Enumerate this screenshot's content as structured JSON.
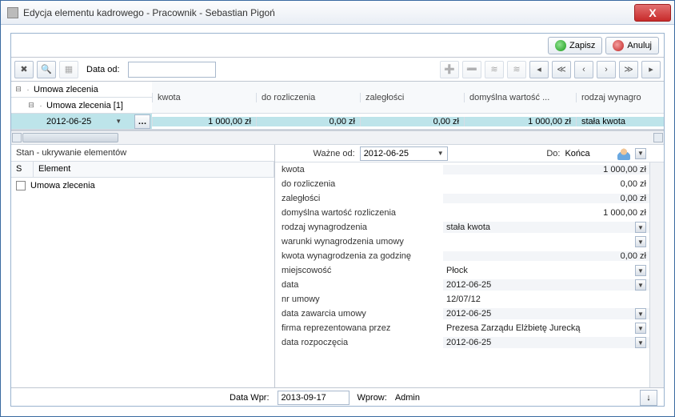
{
  "window": {
    "title": "Edycja elementu kadrowego - Pracownik - Sebastian Pigoń"
  },
  "actions": {
    "save": "Zapisz",
    "cancel": "Anuluj"
  },
  "toolbar": {
    "date_from_label": "Data od:",
    "date_from_value": ""
  },
  "tree": {
    "root": "Umowa zlecenia",
    "child": "Umowa zlecenia [1]",
    "leaf": "2012-06-25"
  },
  "grid": {
    "columns": [
      "kwota",
      "do rozliczenia",
      "zaległości",
      "domyślna wartość ...",
      "rodzaj wynagro"
    ],
    "row": [
      "1 000,00 zł",
      "0,00 zł",
      "0,00 zł",
      "1 000,00 zł",
      "stała kwota"
    ]
  },
  "left_panel": {
    "title": "Stan - ukrywanie elementów",
    "cols": [
      "S",
      "Element"
    ],
    "item": "Umowa zlecenia"
  },
  "form": {
    "valid_from_label": "Ważne od:",
    "valid_from_value": "2012-06-25",
    "to_label": "Do:",
    "to_value": "Końca",
    "rows": [
      {
        "k": "kwota",
        "v": "1 000,00 zł",
        "align": "right",
        "dd": false
      },
      {
        "k": "do rozliczenia",
        "v": "0,00 zł",
        "align": "right",
        "dd": false
      },
      {
        "k": "zaległości",
        "v": "0,00 zł",
        "align": "right",
        "dd": false
      },
      {
        "k": "domyślna wartość rozliczenia",
        "v": "1 000,00 zł",
        "align": "right",
        "dd": false
      },
      {
        "k": "rodzaj wynagrodzenia",
        "v": "stała kwota",
        "align": "left",
        "dd": true
      },
      {
        "k": "warunki wynagrodzenia umowy",
        "v": "",
        "align": "left",
        "dd": true
      },
      {
        "k": "kwota wynagrodzenia za godzinę",
        "v": "0,00 zł",
        "align": "right",
        "dd": false
      },
      {
        "k": "miejscowość",
        "v": "Płock",
        "align": "left",
        "dd": true
      },
      {
        "k": "data",
        "v": "2012-06-25",
        "align": "left",
        "dd": true
      },
      {
        "k": "nr umowy",
        "v": "12/07/12",
        "align": "left",
        "dd": false
      },
      {
        "k": "data zawarcia umowy",
        "v": "2012-06-25",
        "align": "left",
        "dd": true
      },
      {
        "k": "firma reprezentowana przez",
        "v": "Prezesa Zarządu Elżbietę Jurecką",
        "align": "left",
        "dd": true
      },
      {
        "k": "data rozpoczęcia",
        "v": "2012-06-25",
        "align": "left",
        "dd": true
      }
    ]
  },
  "footer": {
    "date_wpr_label": "Data Wpr:",
    "date_wpr_value": "2013-09-17",
    "wprow_label": "Wprow:",
    "wprow_value": "Admin"
  }
}
